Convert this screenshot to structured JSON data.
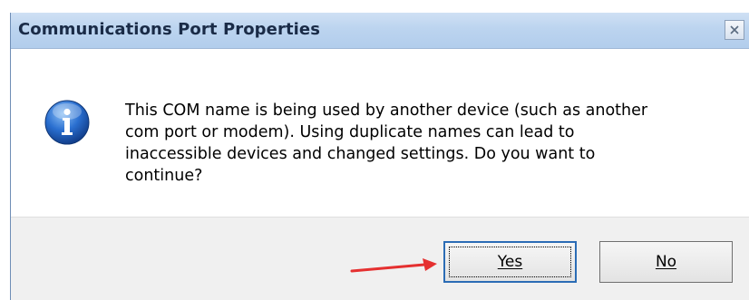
{
  "window": {
    "title": "Communications Port Properties",
    "close_symbol": "×"
  },
  "dialog": {
    "icon": "info-icon",
    "message_lines": [
      "This COM name is being used by another device (such as another",
      "com port or modem).  Using duplicate names can lead to",
      "inaccessible devices and changed settings.  Do you want to",
      "continue?"
    ]
  },
  "buttons": {
    "yes_label": "Yes",
    "no_label": "No"
  },
  "annotation": {
    "arrow_color": "#e53030",
    "arrow_target": "yes-button"
  },
  "colors": {
    "titlebar": "#bcd4ef",
    "footer": "#f0f0f0",
    "accent": "#2b6cb5"
  }
}
